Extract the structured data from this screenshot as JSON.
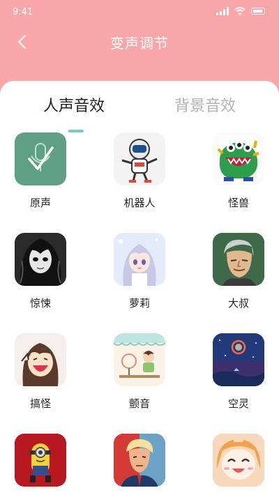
{
  "status_bar": {
    "time": "9:41"
  },
  "header": {
    "title": "变声调节"
  },
  "tabs": [
    {
      "label": "人声音效",
      "active": true
    },
    {
      "label": "背景音效",
      "active": false
    }
  ],
  "effects": [
    {
      "label": "原声",
      "icon": "microphone-check-icon",
      "selected": true
    },
    {
      "label": "机器人",
      "icon": "robot-astronaut-icon"
    },
    {
      "label": "怪兽",
      "icon": "monster-icon"
    },
    {
      "label": "惊悚",
      "icon": "horror-girl-icon"
    },
    {
      "label": "萝莉",
      "icon": "anime-girl-icon"
    },
    {
      "label": "大叔",
      "icon": "uncle-face-icon"
    },
    {
      "label": "搞怪",
      "icon": "funny-girl-icon"
    },
    {
      "label": "颤音",
      "icon": "fan-scene-icon"
    },
    {
      "label": "空灵",
      "icon": "night-sky-icon"
    },
    {
      "label": "",
      "icon": "minion-icon"
    },
    {
      "label": "",
      "icon": "portrait-icon"
    },
    {
      "label": "",
      "icon": "smiling-anime-icon"
    }
  ],
  "colors": {
    "header_bg": "#f9a7a8",
    "accent": "#7fc9c0",
    "selected_tile": "#5f9f86"
  }
}
